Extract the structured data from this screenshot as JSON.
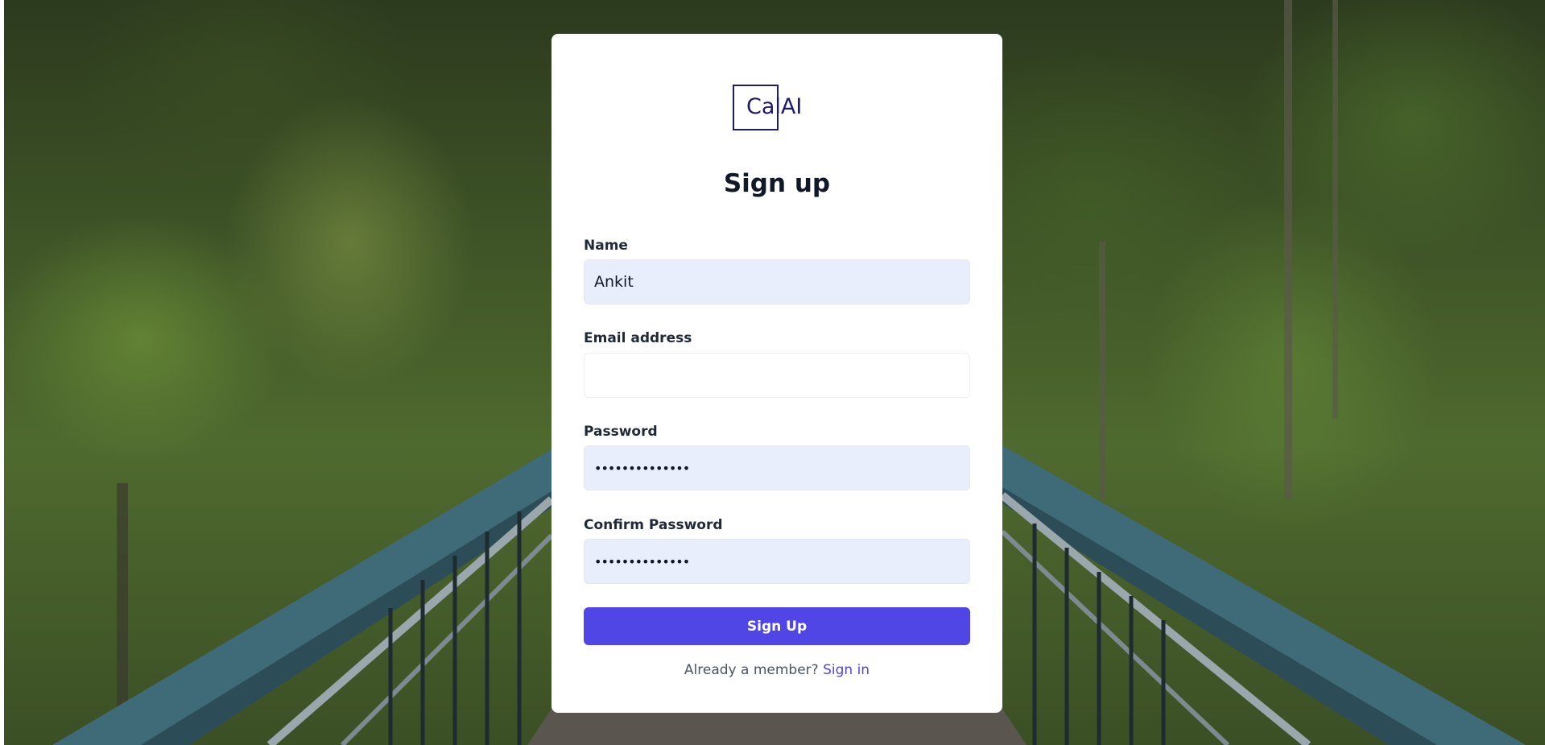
{
  "brand": {
    "logo_text": "CalAI"
  },
  "form": {
    "title": "Sign up",
    "name": {
      "label": "Name",
      "value": "Ankit"
    },
    "email": {
      "label": "Email address",
      "value": ""
    },
    "password": {
      "label": "Password",
      "value": "••••••••••••••"
    },
    "confirm_password": {
      "label": "Confirm Password",
      "value": "••••••••••••••"
    },
    "submit_label": "Sign Up",
    "footer_text": "Already a member?",
    "signin_link": "Sign in"
  },
  "colors": {
    "primary": "#4f46e5",
    "logo": "#1e1b6e",
    "input_fill": "#e8eefb"
  }
}
